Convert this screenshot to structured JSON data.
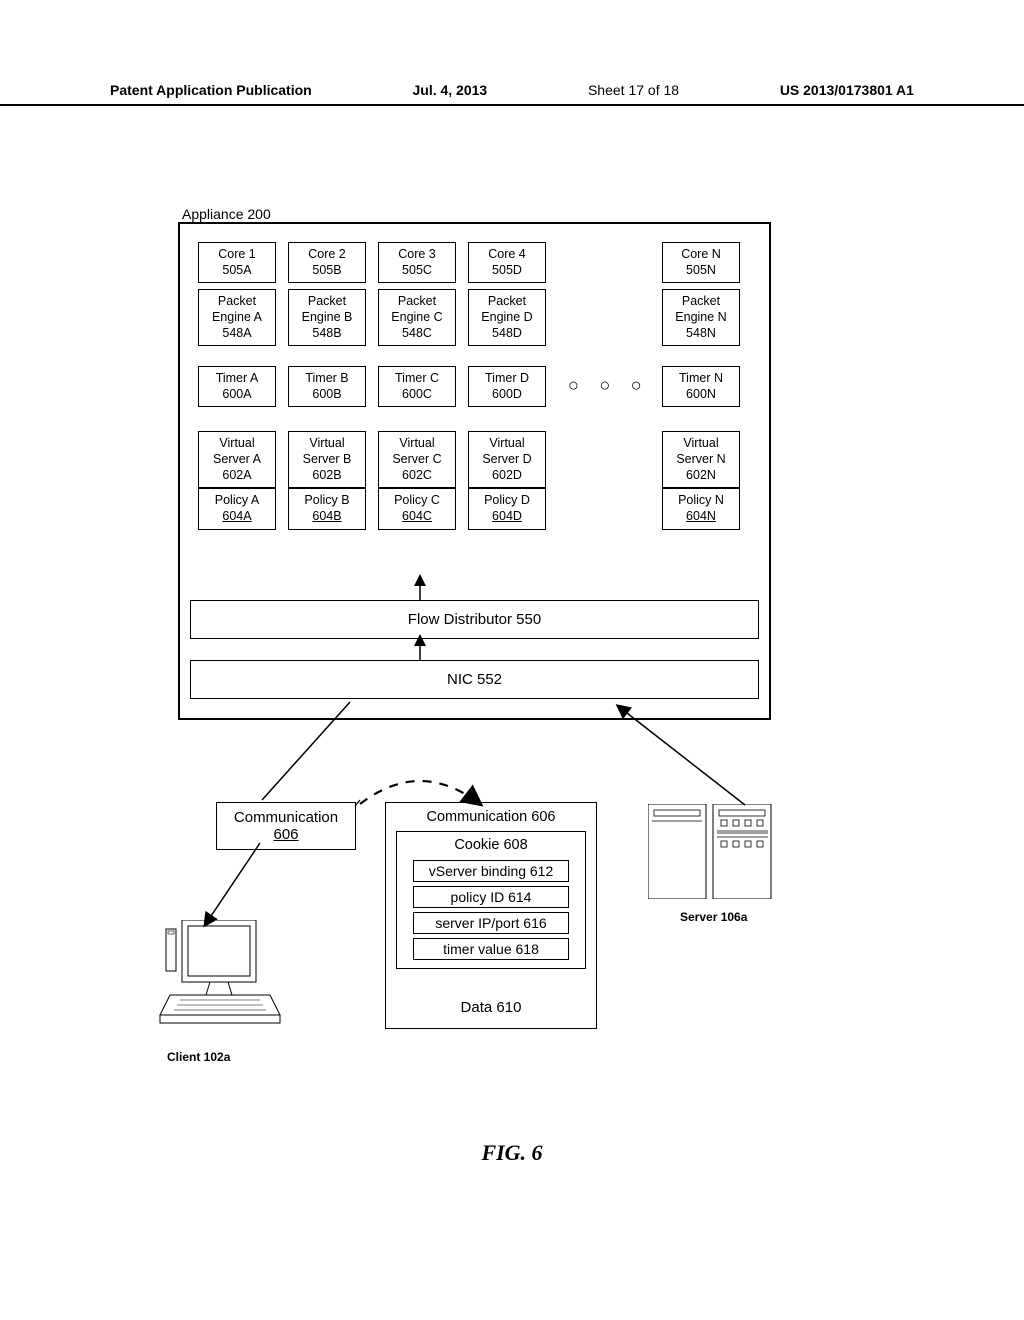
{
  "header": {
    "left": "Patent Application Publication",
    "date": "Jul. 4, 2013",
    "sheet": "Sheet 17 of 18",
    "pubno": "US 2013/0173801 A1"
  },
  "appliance_label": "Appliance 200",
  "cores": [
    {
      "core": "Core 1",
      "coreId": "505A",
      "pe": "Packet",
      "peLine2": "Engine A",
      "peId": "548A",
      "timer": "Timer A",
      "timerId": "600A",
      "vs": "Virtual",
      "vsLine2": "Server A",
      "vsId": "602A",
      "policy": "Policy A",
      "policyId": "604A"
    },
    {
      "core": "Core 2",
      "coreId": "505B",
      "pe": "Packet",
      "peLine2": "Engine B",
      "peId": "548B",
      "timer": "Timer B",
      "timerId": "600B",
      "vs": "Virtual",
      "vsLine2": "Server B",
      "vsId": "602B",
      "policy": "Policy B",
      "policyId": "604B"
    },
    {
      "core": "Core 3",
      "coreId": "505C",
      "pe": "Packet",
      "peLine2": "Engine C",
      "peId": "548C",
      "timer": "Timer C",
      "timerId": "600C",
      "vs": "Virtual",
      "vsLine2": "Server C",
      "vsId": "602C",
      "policy": "Policy C",
      "policyId": "604C"
    },
    {
      "core": "Core 4",
      "coreId": "505D",
      "pe": "Packet",
      "peLine2": "Engine D",
      "peId": "548D",
      "timer": "Timer D",
      "timerId": "600D",
      "vs": "Virtual",
      "vsLine2": "Server D",
      "vsId": "602D",
      "policy": "Policy D",
      "policyId": "604D"
    },
    {
      "core": "Core N",
      "coreId": "505N",
      "pe": "Packet",
      "peLine2": "Engine N",
      "peId": "548N",
      "timer": "Timer N",
      "timerId": "600N",
      "vs": "Virtual",
      "vsLine2": "Server N",
      "vsId": "602N",
      "policy": "Policy N",
      "policyId": "604N"
    }
  ],
  "ellipsis": "○ ○ ○",
  "flow_distributor": "Flow Distributor 550",
  "nic": "NIC 552",
  "comm1": {
    "title": "Communication",
    "id": "606"
  },
  "comm2": {
    "title": "Communication 606",
    "cookie": "Cookie 608",
    "vbind": "vServer binding 612",
    "pid": "policy ID 614",
    "ipport": "server IP/port 616",
    "tval": "timer value 618",
    "data": "Data 610"
  },
  "client_label": "Client 102a",
  "server_label": "Server 106a",
  "fig": "FIG. 6"
}
